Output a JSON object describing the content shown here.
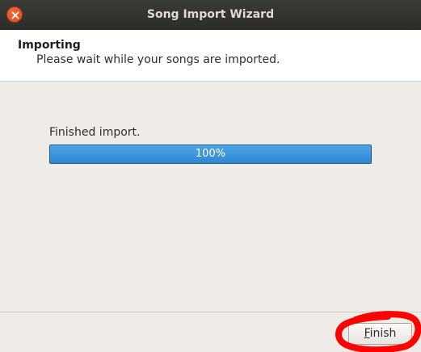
{
  "window": {
    "title": "Song Import Wizard",
    "close_icon": "close-icon"
  },
  "header": {
    "title": "Importing",
    "subtitle": "Please wait while your songs are imported."
  },
  "main": {
    "status_text": "Finished import.",
    "progress": {
      "value_percent": 100,
      "label": "100%"
    }
  },
  "footer": {
    "finish_mnemonic": "F",
    "finish_rest": "inish"
  },
  "colors": {
    "titlebar": "#2d2d2a",
    "close_button": "#df4a16",
    "progress_fill": "#3a94dc",
    "annotation": "#ff0000"
  }
}
